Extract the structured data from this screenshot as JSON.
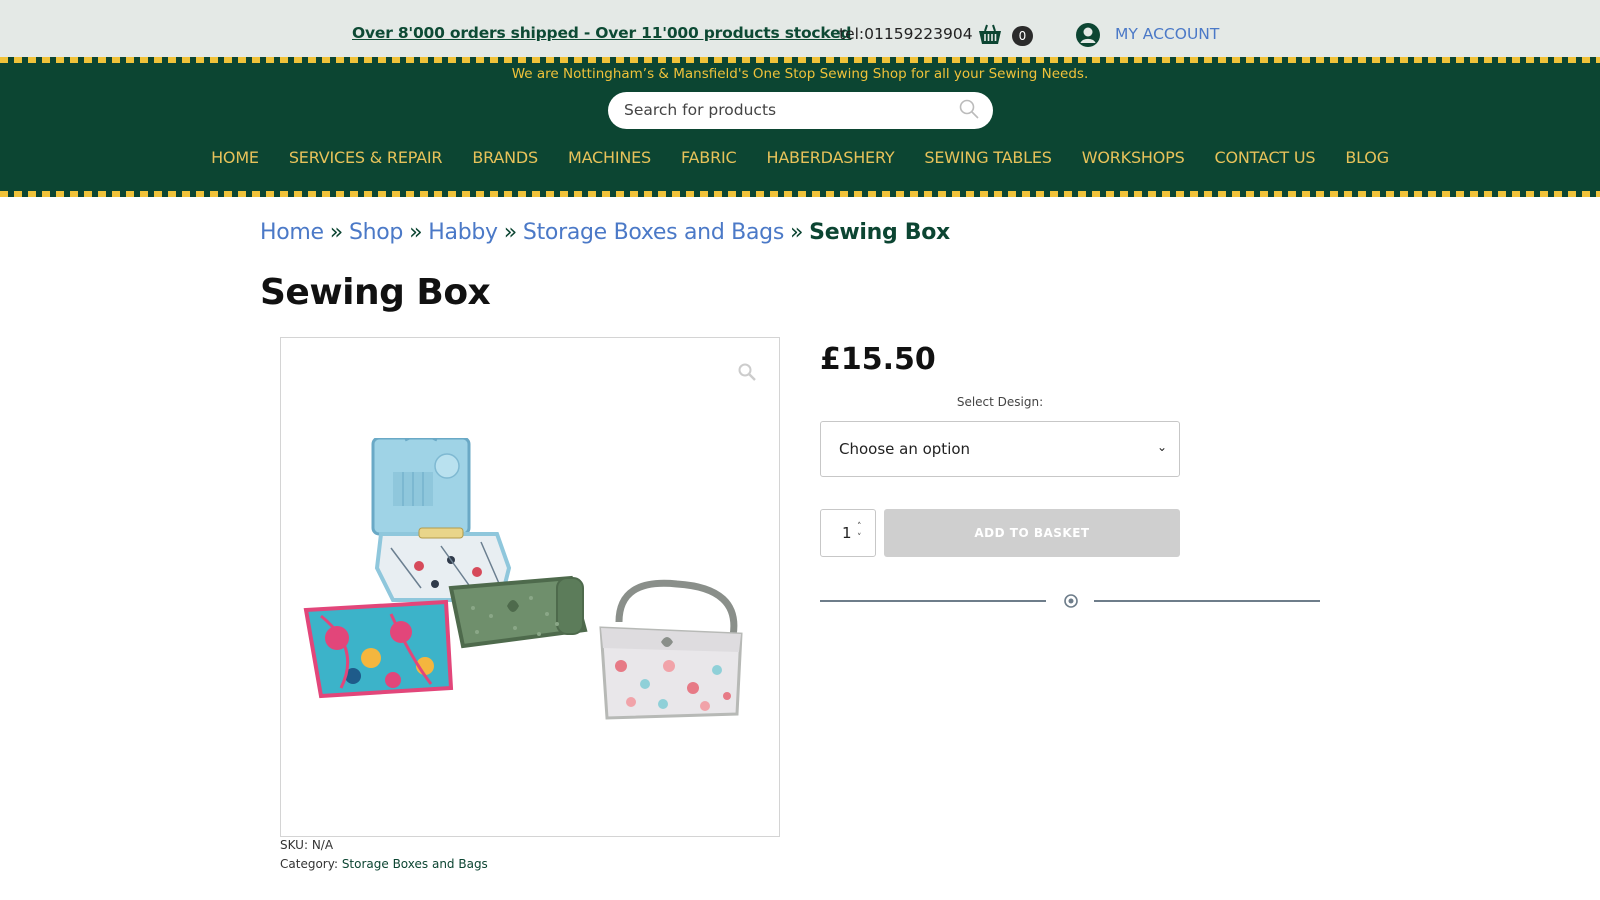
{
  "topbar": {
    "promo": "Over 8'000 orders shipped - Over 11'000 products stocked",
    "tel": "tel:01159223904",
    "cart_icon": "basket-icon",
    "cart_count": "0",
    "account_icon": "user-circle-icon",
    "account_label": "MY ACCOUNT"
  },
  "header": {
    "tagline": "We are Nottingham’s & Mansfield's One Stop Sewing Shop for all your Sewing Needs.",
    "search": {
      "placeholder": "Search for products",
      "icon": "search-icon"
    },
    "nav": [
      "HOME",
      "SERVICES & REPAIR",
      "BRANDS",
      "MACHINES",
      "FABRIC",
      "HABERDASHERY",
      "SEWING TABLES",
      "WORKSHOPS",
      "CONTACT US",
      "BLOG"
    ]
  },
  "breadcrumb": {
    "items": [
      "Home",
      "Shop",
      "Habby",
      "Storage Boxes and Bags"
    ],
    "separator": "»",
    "current": "Sewing Box"
  },
  "product": {
    "title": "Sewing Box",
    "price": "£15.50",
    "select_label": "Select Design:",
    "select_value": "Choose an option",
    "quantity": "1",
    "add_button": "ADD TO BASKET",
    "sku_label": "SKU:",
    "sku_value": "N/A",
    "category_label": "Category:",
    "category_value": "Storage Boxes and Bags",
    "zoom_icon": "magnifier-icon"
  },
  "colors": {
    "brand_green": "#0c4532",
    "brand_gold": "#f0c23a",
    "link_blue": "#4b79c7"
  }
}
